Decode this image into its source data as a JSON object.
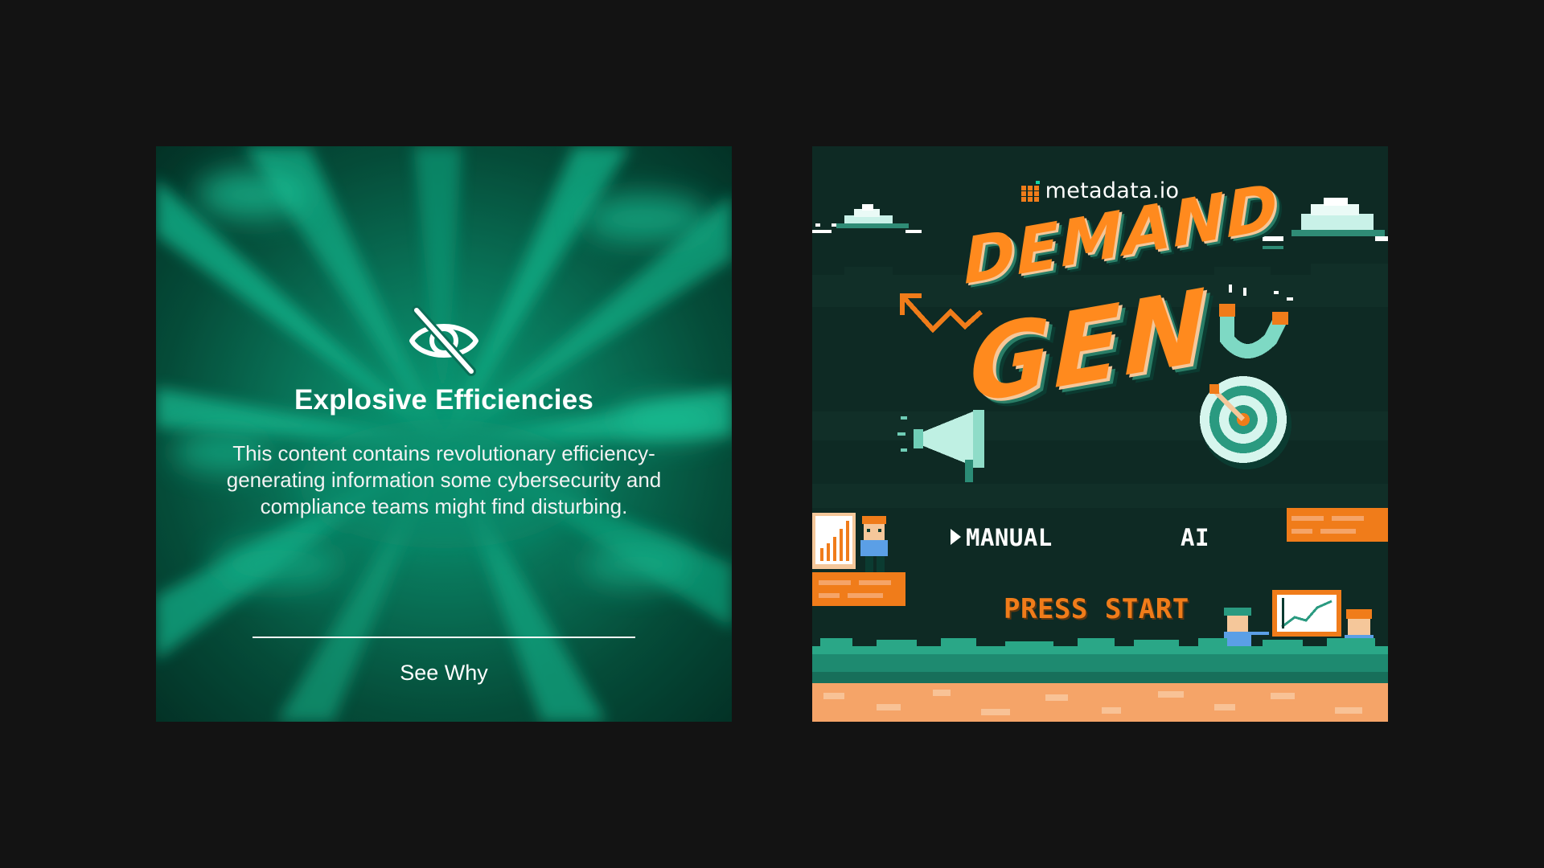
{
  "left_card": {
    "headline": "Explosive Efficiencies",
    "body": "This content contains revolutionary efficiency-generating information some cybersecurity and compliance teams might find disturbing.",
    "cta": "See Why",
    "icon": "eye-slash-icon",
    "colors": {
      "accent": "#13d3a3",
      "base": "#063a2e"
    }
  },
  "right_card": {
    "brand": {
      "name": "metadata.io",
      "logo_icon": "metadata-logo-icon",
      "logo_color": "#f07c1a"
    },
    "title_line_1": "DEMAND",
    "title_line_2": "GEN",
    "menu": {
      "option_1": "MANUAL",
      "option_2": "AI",
      "selected": "MANUAL"
    },
    "press_start": "PRESS START",
    "colors": {
      "background": "#0e2a24",
      "title": "#ff8a1e",
      "ground": "#f5a468",
      "grass": "#1e8a70"
    }
  },
  "page": {
    "background": "#131313"
  }
}
